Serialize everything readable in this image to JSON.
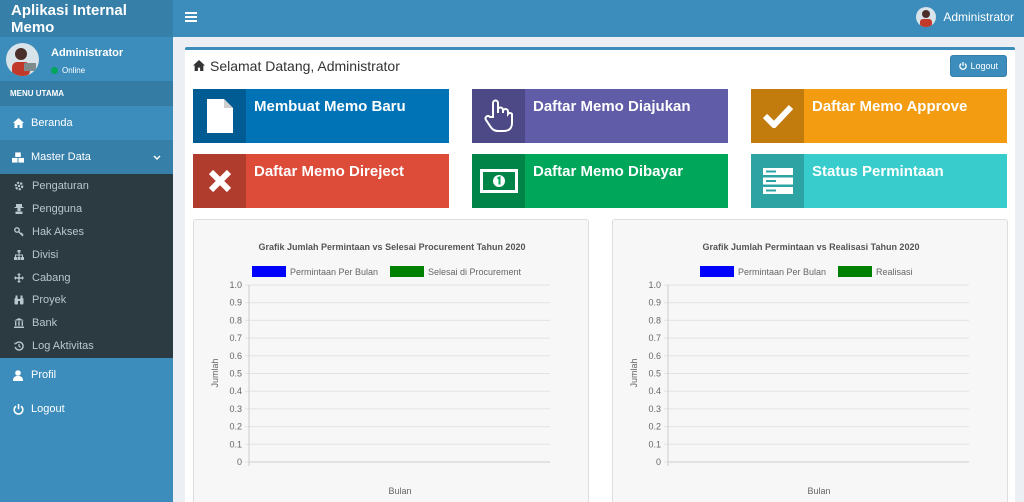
{
  "app": {
    "title": "Aplikasi Internal Memo"
  },
  "topbar": {
    "user_name": "Administrator"
  },
  "sidebar": {
    "user_name": "Administrator",
    "status": "Online",
    "menu_header": "MENU UTAMA",
    "items": [
      {
        "label": "Beranda",
        "icon": "home-icon"
      },
      {
        "label": "Master Data",
        "icon": "cubes-icon"
      }
    ],
    "sub_items": [
      {
        "label": "Pengaturan",
        "icon": "gear-icon"
      },
      {
        "label": "Pengguna",
        "icon": "user-secret-icon"
      },
      {
        "label": "Hak Akses",
        "icon": "key-icon"
      },
      {
        "label": "Divisi",
        "icon": "sitemap-icon"
      },
      {
        "label": "Cabang",
        "icon": "arrows-icon"
      },
      {
        "label": "Proyek",
        "icon": "binoculars-icon"
      },
      {
        "label": "Bank",
        "icon": "bank-icon"
      },
      {
        "label": "Log Aktivitas",
        "icon": "history-icon"
      }
    ],
    "bottom_items": [
      {
        "label": "Profil",
        "icon": "user-icon"
      },
      {
        "label": "Logout",
        "icon": "power-icon"
      }
    ]
  },
  "main": {
    "welcome": "Selamat Datang, Administrator",
    "logout_label": "Logout",
    "tiles": [
      {
        "label": "Membuat Memo Baru",
        "icon": "file-icon",
        "color": "#0073b7"
      },
      {
        "label": "Daftar Memo Diajukan",
        "icon": "hand-pointer-icon",
        "color": "#605ca8"
      },
      {
        "label": "Daftar Memo Approve",
        "icon": "check-icon",
        "color": "#f39c12"
      },
      {
        "label": "Daftar Memo Direject",
        "icon": "times-icon",
        "color": "#dd4b39"
      },
      {
        "label": "Daftar Memo Dibayar",
        "icon": "money-icon",
        "color": "#00a65a"
      },
      {
        "label": "Status Permintaan",
        "icon": "server-icon",
        "color": "#39cccc"
      }
    ]
  },
  "chart_data": [
    {
      "type": "bar",
      "title": "Grafik Jumlah Permintaan vs Selesai Procurement Tahun 2020",
      "xlabel": "Bulan",
      "ylabel": "Jumlah",
      "ylim": [
        0,
        1.0
      ],
      "yticks": [
        "1.0",
        "0.9",
        "0.8",
        "0.7",
        "0.6",
        "0.5",
        "0.4",
        "0.3",
        "0.2",
        "0.1",
        "0"
      ],
      "grid": true,
      "legend_position": "top",
      "categories": [],
      "series": [
        {
          "name": "Permintaan Per Bulan",
          "color": "#0000ff",
          "values": []
        },
        {
          "name": "Selesai di Procurement",
          "color": "#008000",
          "values": []
        }
      ]
    },
    {
      "type": "bar",
      "title": "Grafik Jumlah Permintaan vs Realisasi Tahun 2020",
      "xlabel": "Bulan",
      "ylabel": "Jumlah",
      "ylim": [
        0,
        1.0
      ],
      "yticks": [
        "1.0",
        "0.9",
        "0.8",
        "0.7",
        "0.6",
        "0.5",
        "0.4",
        "0.3",
        "0.2",
        "0.1",
        "0"
      ],
      "grid": true,
      "legend_position": "top",
      "categories": [],
      "series": [
        {
          "name": "Permintaan Per Bulan",
          "color": "#0000ff",
          "values": []
        },
        {
          "name": "Realisasi",
          "color": "#008000",
          "values": []
        }
      ]
    }
  ]
}
